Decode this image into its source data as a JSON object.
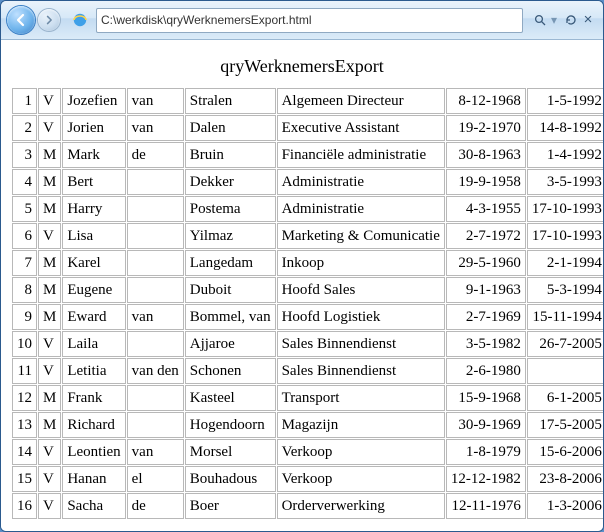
{
  "browser": {
    "address": "C:\\werkdisk\\qryWerknemersExport.html",
    "search_glyph": "🔍",
    "refresh_glyph": "↻",
    "close_glyph": "×",
    "separator": "▾"
  },
  "page": {
    "title": "qryWerknemersExport"
  },
  "rows": [
    {
      "n": "1",
      "g": "V",
      "first": "Jozefien",
      "tus": "van",
      "last": "Stralen",
      "func": "Algemeen Directeur",
      "d1": "8-12-1968",
      "d2": "1-5-1992"
    },
    {
      "n": "2",
      "g": "V",
      "first": "Jorien",
      "tus": "van",
      "last": "Dalen",
      "func": "Executive Assistant",
      "d1": "19-2-1970",
      "d2": "14-8-1992"
    },
    {
      "n": "3",
      "g": "M",
      "first": "Mark",
      "tus": "de",
      "last": "Bruin",
      "func": "Financiële administratie",
      "d1": "30-8-1963",
      "d2": "1-4-1992"
    },
    {
      "n": "4",
      "g": "M",
      "first": "Bert",
      "tus": "",
      "last": "Dekker",
      "func": "Administratie",
      "d1": "19-9-1958",
      "d2": "3-5-1993"
    },
    {
      "n": "5",
      "g": "M",
      "first": "Harry",
      "tus": "",
      "last": "Postema",
      "func": "Administratie",
      "d1": "4-3-1955",
      "d2": "17-10-1993"
    },
    {
      "n": "6",
      "g": "V",
      "first": "Lisa",
      "tus": "",
      "last": "Yilmaz",
      "func": "Marketing & Comunicatie",
      "d1": "2-7-1972",
      "d2": "17-10-1993"
    },
    {
      "n": "7",
      "g": "M",
      "first": "Karel",
      "tus": "",
      "last": "Langedam",
      "func": "Inkoop",
      "d1": "29-5-1960",
      "d2": "2-1-1994"
    },
    {
      "n": "8",
      "g": "M",
      "first": "Eugene",
      "tus": "",
      "last": "Duboit",
      "func": "Hoofd Sales",
      "d1": "9-1-1963",
      "d2": "5-3-1994"
    },
    {
      "n": "9",
      "g": "M",
      "first": "Eward",
      "tus": "van",
      "last": "Bommel, van",
      "func": "Hoofd Logistiek",
      "d1": "2-7-1969",
      "d2": "15-11-1994"
    },
    {
      "n": "10",
      "g": "V",
      "first": "Laila",
      "tus": "",
      "last": "Ajjaroe",
      "func": "Sales Binnendienst",
      "d1": "3-5-1982",
      "d2": "26-7-2005"
    },
    {
      "n": "11",
      "g": "V",
      "first": "Letitia",
      "tus": "van den",
      "last": "Schonen",
      "func": "Sales Binnendienst",
      "d1": "2-6-1980",
      "d2": ""
    },
    {
      "n": "12",
      "g": "M",
      "first": "Frank",
      "tus": "",
      "last": "Kasteel",
      "func": "Transport",
      "d1": "15-9-1968",
      "d2": "6-1-2005"
    },
    {
      "n": "13",
      "g": "M",
      "first": "Richard",
      "tus": "",
      "last": "Hogendoorn",
      "func": "Magazijn",
      "d1": "30-9-1969",
      "d2": "17-5-2005"
    },
    {
      "n": "14",
      "g": "V",
      "first": "Leontien",
      "tus": "van",
      "last": "Morsel",
      "func": "Verkoop",
      "d1": "1-8-1979",
      "d2": "15-6-2006"
    },
    {
      "n": "15",
      "g": "V",
      "first": "Hanan",
      "tus": "el",
      "last": "Bouhadous",
      "func": "Verkoop",
      "d1": "12-12-1982",
      "d2": "23-8-2006"
    },
    {
      "n": "16",
      "g": "V",
      "first": "Sacha",
      "tus": "de",
      "last": "Boer",
      "func": "Orderverwerking",
      "d1": "12-11-1976",
      "d2": "1-3-2006"
    }
  ]
}
